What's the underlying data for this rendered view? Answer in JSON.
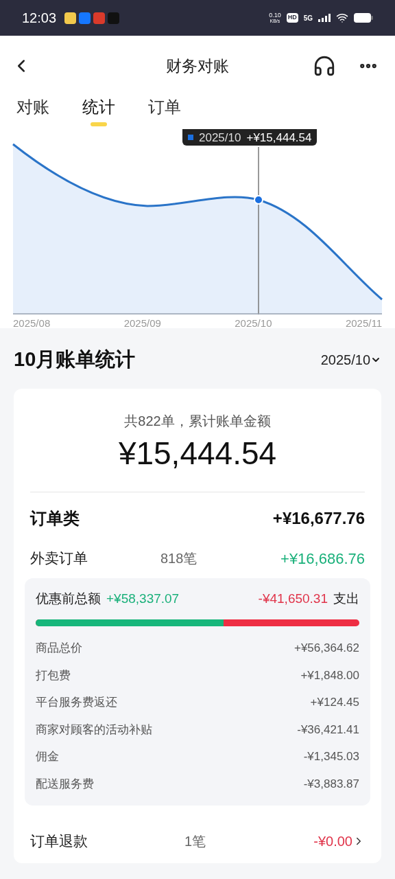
{
  "status_bar": {
    "time": "12:03",
    "net_speed": "0.10",
    "net_unit": "KB/s",
    "hd": "HD",
    "network": "5G"
  },
  "header": {
    "title": "财务对账"
  },
  "tabs": [
    {
      "label": "对账",
      "selected": false
    },
    {
      "label": "统计",
      "selected": true
    },
    {
      "label": "订单",
      "selected": false
    }
  ],
  "chart": {
    "tooltip_date": "2025/10",
    "tooltip_value": "+¥15,444.54",
    "x_labels": [
      "2025/08",
      "2025/09",
      "2025/10",
      "2025/11"
    ]
  },
  "section": {
    "title": "10月账单统计",
    "period": "2025/10"
  },
  "summary": {
    "caption": "共822单，累计账单金额",
    "total": "¥15,444.54"
  },
  "category": {
    "name": "订单类",
    "amount": "+¥16,677.76"
  },
  "orders": {
    "name": "外卖订单",
    "count": "818笔",
    "amount": "+¥16,686.76"
  },
  "breakdown": {
    "income_label": "优惠前总额",
    "income": "+¥58,337.07",
    "expense": "-¥41,650.31",
    "expense_label": "支出",
    "level": 0.58,
    "items": [
      {
        "label": "商品总价",
        "amount": "+¥56,364.62"
      },
      {
        "label": "打包费",
        "amount": "+¥1,848.00"
      },
      {
        "label": "平台服务费返还",
        "amount": "+¥124.45"
      },
      {
        "label": "商家对顾客的活动补贴",
        "amount": "-¥36,421.41"
      },
      {
        "label": "佣金",
        "amount": "-¥1,345.03"
      },
      {
        "label": "配送服务费",
        "amount": "-¥3,883.87"
      }
    ]
  },
  "refund": {
    "name": "订单退款",
    "count": "1笔",
    "amount": "-¥0.00"
  }
}
